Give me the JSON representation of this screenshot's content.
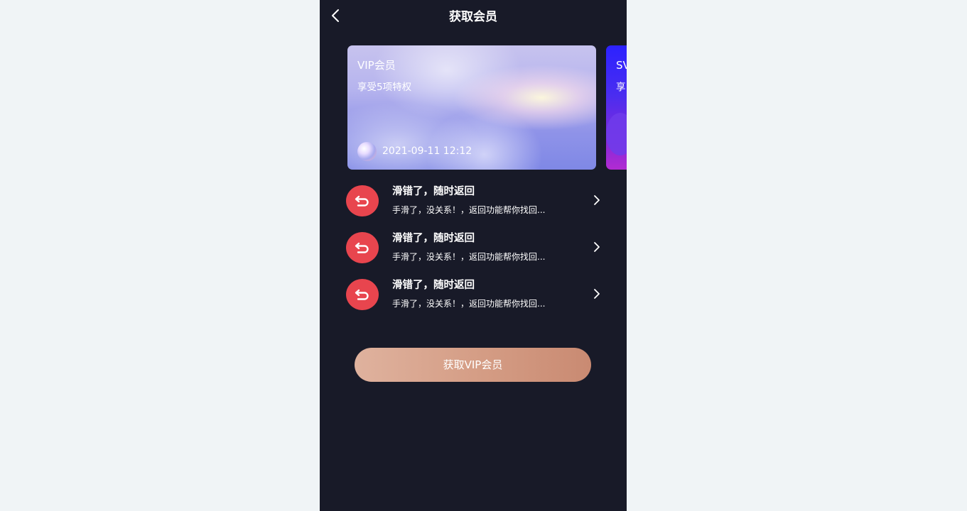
{
  "nav": {
    "title": "获取会员",
    "back_icon": "chevron-left-icon"
  },
  "cards": [
    {
      "title": "VIP会员",
      "subtitle": "享受5项特权",
      "date": "2021-09-11 12:12"
    },
    {
      "title": "SV",
      "subtitle": "享"
    }
  ],
  "items": [
    {
      "icon": "undo-return-icon",
      "title": "滑错了，随时返回",
      "desc": "手滑了，没关系！，返回功能帮你找回..."
    },
    {
      "icon": "undo-return-icon",
      "title": "滑错了，随时返回",
      "desc": "手滑了，没关系！，返回功能帮你找回..."
    },
    {
      "icon": "undo-return-icon",
      "title": "滑错了，随时返回",
      "desc": "手滑了，没关系！，返回功能帮你找回..."
    }
  ],
  "cta": {
    "label": "获取VIP会员"
  },
  "colors": {
    "page_background": "#f0f4f6",
    "app_background": "#181a28",
    "icon_red": "#e8454e",
    "cta_gradient_start": "#dfb29e",
    "cta_gradient_end": "#c98a72"
  }
}
